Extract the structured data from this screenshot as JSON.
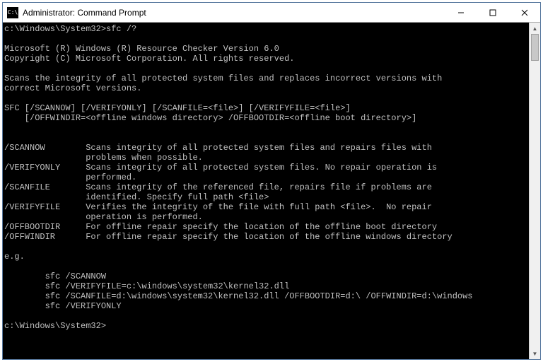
{
  "titlebar": {
    "icon_text": "C:\\",
    "title": "Administrator: Command Prompt"
  },
  "console": {
    "prompt1": "c:\\Windows\\System32>",
    "cmd1": "sfc /?",
    "blank": "",
    "line_ms": "Microsoft (R) Windows (R) Resource Checker Version 6.0",
    "line_cp": "Copyright (C) Microsoft Corporation. All rights reserved.",
    "line_desc1": "Scans the integrity of all protected system files and replaces incorrect versions with",
    "line_desc2": "correct Microsoft versions.",
    "line_usage1": "SFC [/SCANNOW] [/VERIFYONLY] [/SCANFILE=<file>] [/VERIFYFILE=<file>]",
    "line_usage2": "    [/OFFWINDIR=<offline windows directory> /OFFBOOTDIR=<offline boot directory>]",
    "opt_scannow_k": "/SCANNOW        ",
    "opt_scannow_1": "Scans integrity of all protected system files and repairs files with",
    "opt_scannow_pad": "                ",
    "opt_scannow_2": "problems when possible.",
    "opt_verifyonly_k": "/VERIFYONLY     ",
    "opt_verifyonly_1": "Scans integrity of all protected system files. No repair operation is",
    "opt_verifyonly_2": "performed.",
    "opt_scanfile_k": "/SCANFILE       ",
    "opt_scanfile_1": "Scans integrity of the referenced file, repairs file if problems are",
    "opt_scanfile_2": "identified. Specify full path <file>",
    "opt_verifyfile_k": "/VERIFYFILE     ",
    "opt_verifyfile_1": "Verifies the integrity of the file with full path <file>.  No repair",
    "opt_verifyfile_2": "operation is performed.",
    "opt_offboot_k": "/OFFBOOTDIR     ",
    "opt_offboot_1": "For offline repair specify the location of the offline boot directory",
    "opt_offwin_k": "/OFFWINDIR      ",
    "opt_offwin_1": "For offline repair specify the location of the offline windows directory",
    "eg": "e.g.",
    "ex_pad": "        ",
    "ex1": "sfc /SCANNOW",
    "ex2": "sfc /VERIFYFILE=c:\\windows\\system32\\kernel32.dll",
    "ex3": "sfc /SCANFILE=d:\\windows\\system32\\kernel32.dll /OFFBOOTDIR=d:\\ /OFFWINDIR=d:\\windows",
    "ex4": "sfc /VERIFYONLY",
    "prompt2": "c:\\Windows\\System32>"
  }
}
